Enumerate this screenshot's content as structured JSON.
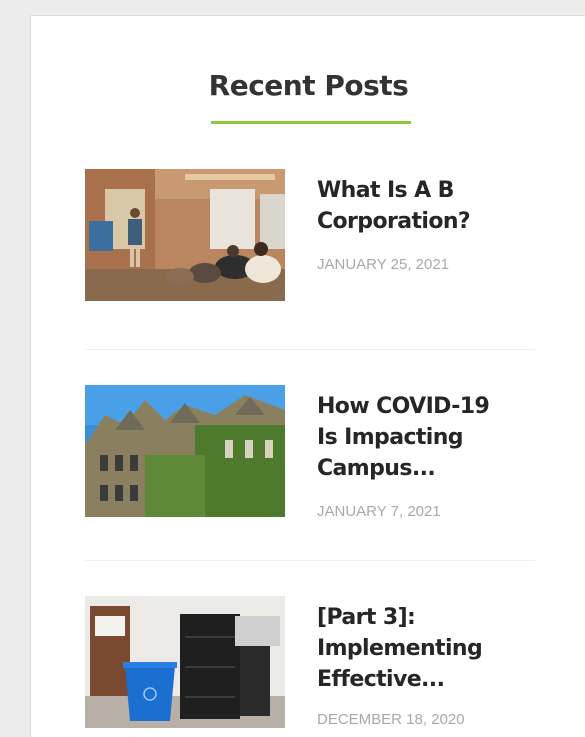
{
  "widget": {
    "title": "Recent Posts",
    "accent_color": "#8dc63f"
  },
  "posts": [
    {
      "title": "What Is A B\nCorporation?",
      "date": "JANUARY 25, 2021",
      "thumbnail": "office-presentation-photo"
    },
    {
      "title": "How COVID-19\nIs Impacting\nCampus...",
      "date": "JANUARY 7, 2021",
      "thumbnail": "campus-building-photo"
    },
    {
      "title": "[Part 3]:\nImplementing\nEffective...",
      "date": "DECEMBER 18, 2020",
      "thumbnail": "office-recycling-bin-photo"
    }
  ]
}
